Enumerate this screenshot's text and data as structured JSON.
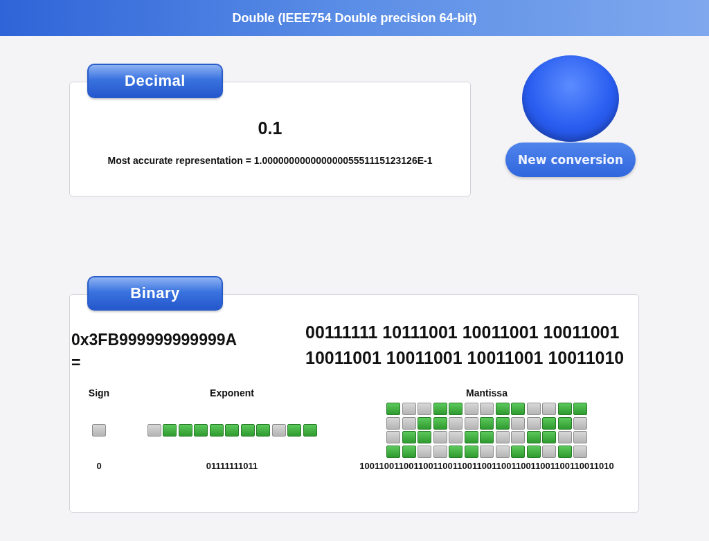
{
  "window": {
    "title": "Double (IEEE754 Double precision 64-bit)"
  },
  "decimal": {
    "tab": "Decimal",
    "value": "0.1",
    "representation": "Most accurate representation = 1.00000000000000005551115123126E-1"
  },
  "new_conversion_button": {
    "label": "New conversion"
  },
  "binary": {
    "tab": "Binary",
    "hex": "0x3FB999999999999A",
    "equals": "=",
    "bits": "00111111 10111001 10011001 10011001 10011001 10011001 10011001 10011010",
    "fields": [
      {
        "kind": "sign",
        "label": "Sign",
        "value": "0"
      },
      {
        "kind": "exponent",
        "label": "Exponent",
        "value": "01111111011"
      },
      {
        "kind": "mantissa",
        "label": "Mantissa",
        "value": "1001100110011001100110011001100110011001100110011010"
      }
    ]
  }
}
